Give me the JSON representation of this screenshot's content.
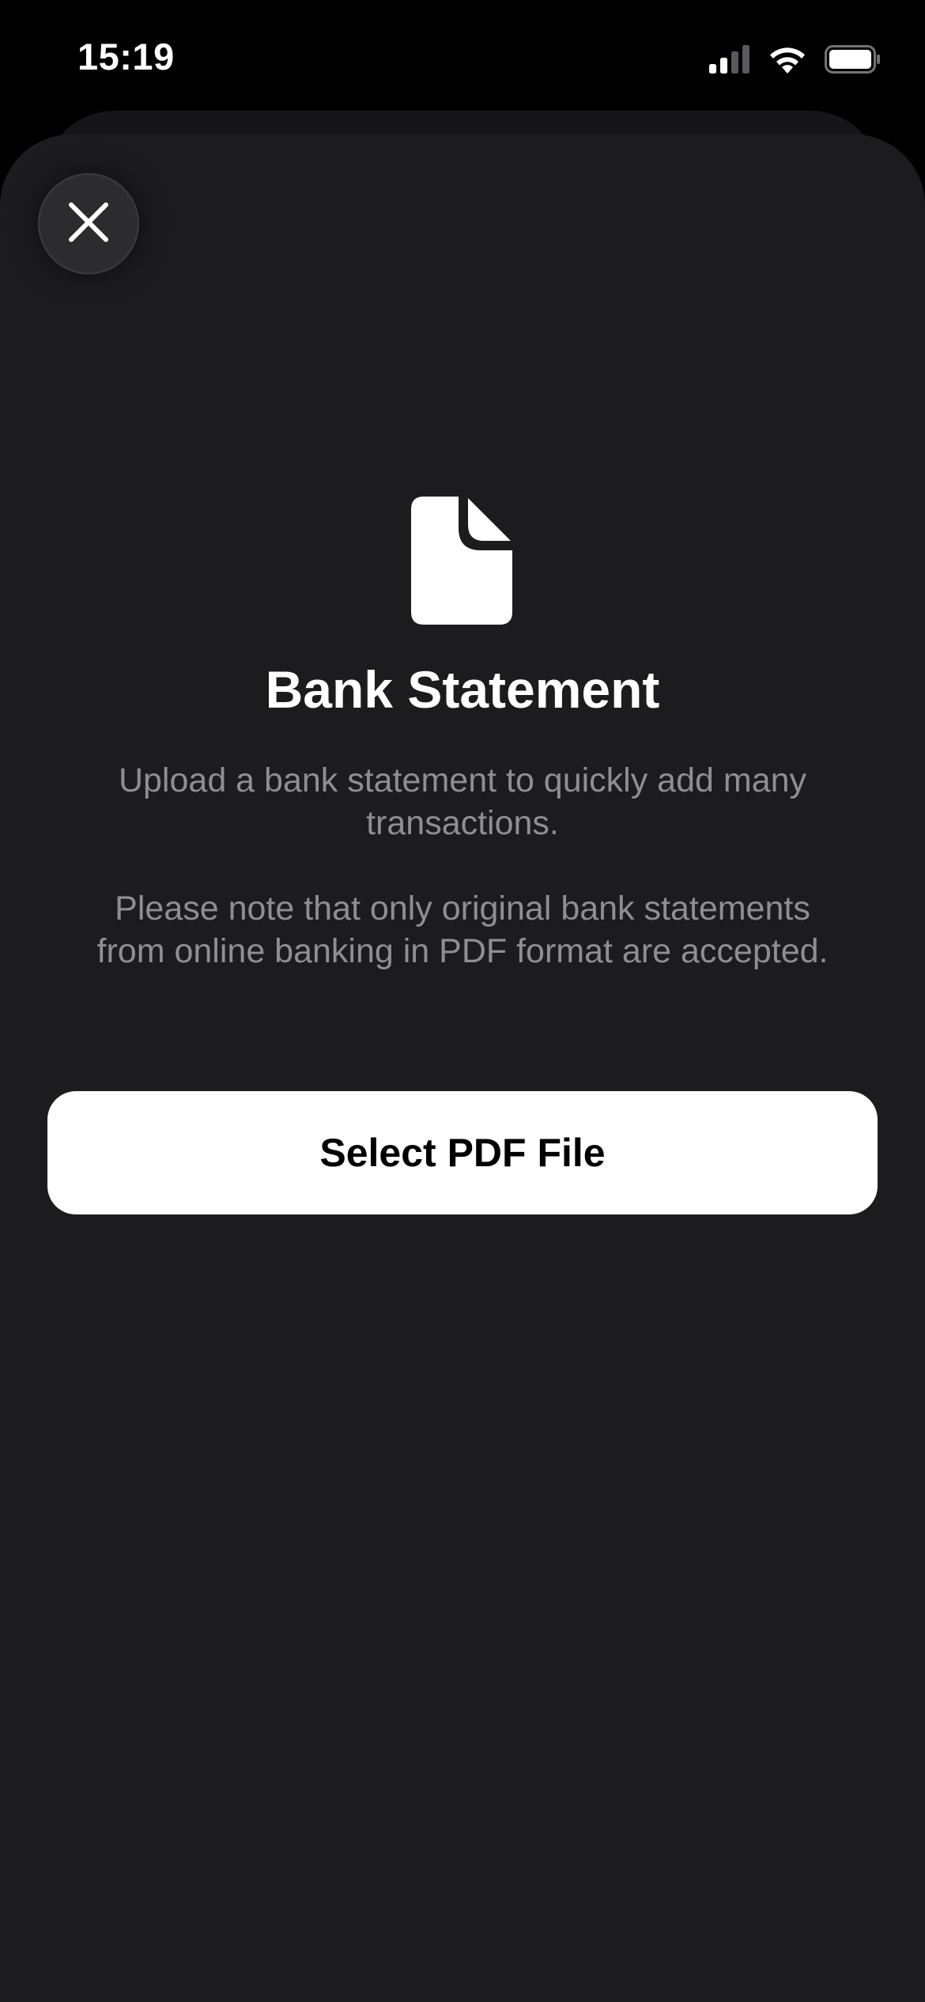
{
  "status_bar": {
    "time": "15:19",
    "icons": [
      "cellular-signal-icon",
      "wifi-icon",
      "battery-icon"
    ]
  },
  "sheet": {
    "close_icon": "close-icon",
    "document_icon": "document-icon",
    "title": "Bank Statement",
    "description_1": "Upload a bank statement to quickly add many transactions.",
    "description_2": "Please note that only original bank statements from online banking in PDF format are accepted.",
    "select_button_label": "Select PDF File"
  },
  "colors": {
    "background": "#000000",
    "sheet": "#1c1c1e",
    "text_primary": "#ffffff",
    "text_secondary": "#8e8e93",
    "button": "#ffffff"
  }
}
